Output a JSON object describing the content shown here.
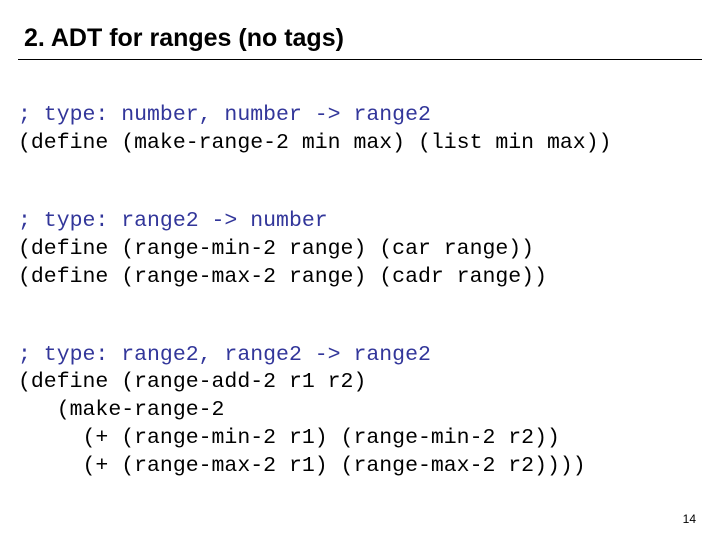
{
  "title": "2. ADT for ranges (no tags)",
  "code": {
    "b1c": "; type: number, number -> range2",
    "b1l1": "(define (make-range-2 min max) (list min max))",
    "b2c": "; type: range2 -> number",
    "b2l1": "(define (range-min-2 range) (car range))",
    "b2l2": "(define (range-max-2 range) (cadr range))",
    "b3c": "; type: range2, range2 -> range2",
    "b3l1": "(define (range-add-2 r1 r2)",
    "b3l2": "   (make-range-2",
    "b3l3": "     (+ (range-min-2 r1) (range-min-2 r2))",
    "b3l4": "     (+ (range-max-2 r1) (range-max-2 r2))))"
  },
  "page": "14"
}
